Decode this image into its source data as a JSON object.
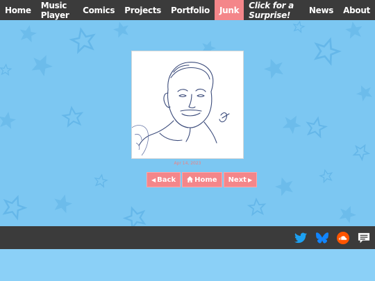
{
  "nav": {
    "items": [
      {
        "label": "Home"
      },
      {
        "label": "Music Player"
      },
      {
        "label": "Comics"
      },
      {
        "label": "Projects"
      },
      {
        "label": "Portfolio"
      },
      {
        "label": "Junk"
      },
      {
        "label": "Click for a Surprise!"
      },
      {
        "label": "News"
      },
      {
        "label": "About"
      }
    ],
    "active": "Junk"
  },
  "post": {
    "date": "Apr 14, 2023",
    "signature": "JP"
  },
  "buttons": {
    "back_label": "Back",
    "home_label": "Home",
    "next_label": "Next"
  },
  "footer": {
    "icons": [
      "twitter-icon",
      "bluesky-icon",
      "soundcloud-icon",
      "chat-icon"
    ]
  },
  "colors": {
    "nav_bg": "#3b3b3b",
    "accent": "#f4868a",
    "background": "#7cc7f2",
    "twitter": "#1da1f2",
    "bluesky": "#1185fe",
    "soundcloud": "#ff5500"
  }
}
